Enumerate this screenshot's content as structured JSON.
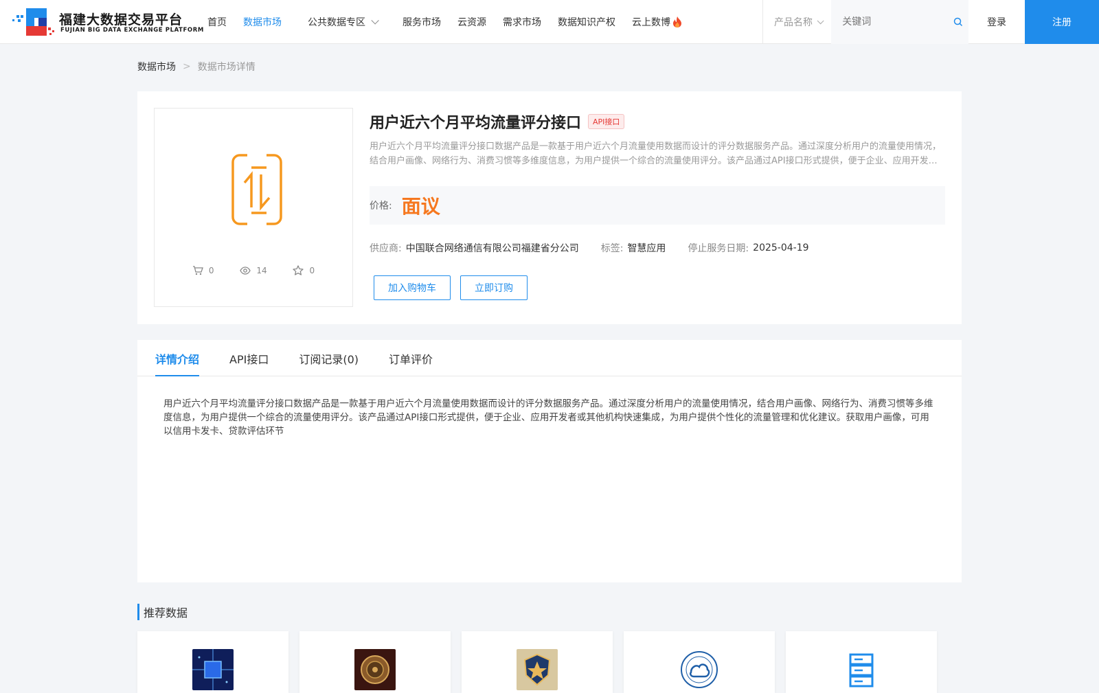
{
  "header": {
    "logo_cn": "福建大数据交易平台",
    "logo_en": "FUJIAN BIG DATA EXCHANGE PLATFORM",
    "nav": [
      {
        "label": "首页",
        "active": false
      },
      {
        "label": "数据市场",
        "active": true
      },
      {
        "label": "公共数据专区",
        "active": false,
        "dropdown": true
      },
      {
        "label": "服务市场",
        "active": false
      },
      {
        "label": "云资源",
        "active": false
      },
      {
        "label": "需求市场",
        "active": false
      },
      {
        "label": "数据知识产权",
        "active": false
      },
      {
        "label": "云上数博",
        "active": false,
        "icon": "fire-icon"
      }
    ],
    "search": {
      "select_value": "产品名称",
      "placeholder": "关键词"
    },
    "login_label": "登录",
    "register_label": "注册"
  },
  "breadcrumb": {
    "root": "数据市场",
    "separator": ">",
    "current": "数据市场详情"
  },
  "product": {
    "title": "用户近六个月平均流量评分接口",
    "badge": "API接口",
    "description": "用户近六个月平均流量评分接口数据产品是一款基于用户近六个月流量使用数据而设计的评分数据服务产品。通过深度分析用户的流量使用情况，结合用户画像、网络行为、消费习惯等多维度信息，为用户提供一个综合的流量使用评分。该产品通过API接口形式提供，便于企业、应用开发者或其他机构快速集成，为用户提供个性化的流量管理和优化建议。获取用户画像，可用以信用卡发卡、贷款评估环节",
    "price_label": "价格:",
    "price_value": "面议",
    "stats": {
      "cart": "0",
      "views": "14",
      "favorites": "0"
    },
    "meta": {
      "supplier_label": "供应商:",
      "supplier": "中国联合网络通信有限公司福建省分公司",
      "tag_label": "标签:",
      "tag": "智慧应用",
      "end_date_label": "停止服务日期:",
      "end_date": "2025-04-19"
    },
    "add_cart_label": "加入购物车",
    "subscribe_label": "立即订购"
  },
  "tabs": [
    {
      "label": "详情介绍",
      "active": true
    },
    {
      "label": "API接口",
      "active": false
    },
    {
      "label": "订阅记录(0)",
      "active": false
    },
    {
      "label": "订单评价",
      "active": false
    }
  ],
  "detail_text": "用户近六个月平均流量评分接口数据产品是一款基于用户近六个月流量使用数据而设计的评分数据服务产品。通过深度分析用户的流量使用情况，结合用户画像、网络行为、消费习惯等多维度信息，为用户提供一个综合的流量使用评分。该产品通过API接口形式提供，便于企业、应用开发者或其他机构快速集成，为用户提供个性化的流量管理和优化建议。获取用户画像，可用以信用卡发卡、贷款评估环节",
  "recommend": {
    "title": "推荐数据",
    "items": [
      {
        "icon": "network-chip-image",
        "color": "#1a3a8a"
      },
      {
        "icon": "bronze-coin-image",
        "color": "#5a2a1a"
      },
      {
        "icon": "police-badge-image",
        "color": "#c89a4a"
      },
      {
        "icon": "weather-bureau-logo",
        "color": "#1f5fa8"
      },
      {
        "icon": "server-rack-icon",
        "color": "#1f8ceb"
      }
    ]
  },
  "colors": {
    "accent": "#1f8ceb",
    "price": "#f6781f",
    "badge": "#e53935"
  }
}
